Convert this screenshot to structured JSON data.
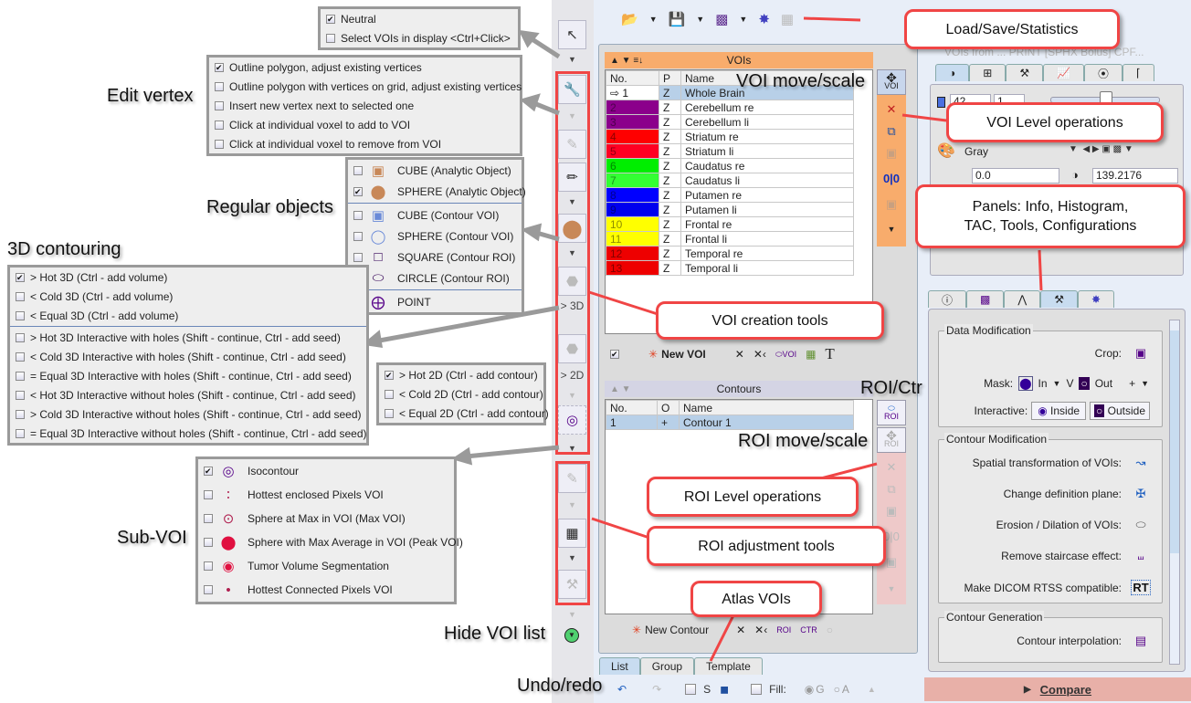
{
  "callouts": {
    "edit_vertex": "Edit vertex",
    "regular_objects": "Regular objects",
    "contouring_3d": "3D contouring",
    "sub_voi": "Sub-VOI",
    "hide_voi_list": "Hide VOI list",
    "undo_redo": "Undo/redo",
    "voi_move_scale": "VOI move/scale",
    "roi_ctr": "ROI/Ctr",
    "roi_move_scale": "ROI move/scale"
  },
  "bubbles": {
    "load_save": "Load/Save/Statistics",
    "voi_level": "VOI Level operations",
    "panels_line1": "Panels: Info, Histogram,",
    "panels_line2": "TAC, Tools, Configurations",
    "voi_creation": "VOI creation tools",
    "roi_level": "ROI Level operations",
    "roi_adjust": "ROI adjustment tools",
    "atlas": "Atlas VOIs"
  },
  "menus": {
    "select": [
      {
        "label": "Neutral",
        "checked": true
      },
      {
        "label": "Select VOIs in display <Ctrl+Click>",
        "checked": false
      }
    ],
    "edit_vertex": [
      {
        "label": "Outline polygon, adjust existing vertices",
        "checked": true
      },
      {
        "label": "Outline polygon with vertices on grid, adjust existing vertices",
        "checked": false
      },
      {
        "label": "Insert new vertex next to selected one",
        "checked": false
      },
      {
        "label": "Click at individual voxel to add to VOI",
        "checked": false
      },
      {
        "label": "Click at individual voxel to remove from VOI",
        "checked": false
      }
    ],
    "regular_objects": [
      {
        "label": "CUBE (Analytic Object)",
        "checked": false,
        "icon": "cube-analytic-icon"
      },
      {
        "label": "SPHERE (Analytic Object)",
        "checked": true,
        "icon": "sphere-analytic-icon"
      },
      {
        "label": "CUBE (Contour VOI)",
        "checked": false,
        "icon": "cube-contour-icon"
      },
      {
        "label": "SPHERE (Contour VOI)",
        "checked": false,
        "icon": "sphere-contour-icon"
      },
      {
        "label": "SQUARE (Contour ROI)",
        "checked": false,
        "icon": "square-icon"
      },
      {
        "label": "CIRCLE (Contour ROI)",
        "checked": false,
        "icon": "circle-icon"
      },
      {
        "label": "POINT",
        "checked": false,
        "icon": "point-icon"
      }
    ],
    "contouring_3d": [
      {
        "label": "> Hot 3D (Ctrl - add volume)",
        "checked": true
      },
      {
        "label": "< Cold 3D (Ctrl - add volume)",
        "checked": false
      },
      {
        "label": "< Equal 3D (Ctrl - add volume)",
        "checked": false
      },
      {
        "label": "> Hot 3D Interactive with holes (Shift - continue, Ctrl - add seed)",
        "checked": false
      },
      {
        "label": "< Cold 3D Interactive with holes (Shift - continue, Ctrl - add seed)",
        "checked": false
      },
      {
        "label": "= Equal 3D Interactive with holes (Shift - continue, Ctrl - add seed)",
        "checked": false
      },
      {
        "label": "< Hot 3D Interactive without holes (Shift - continue, Ctrl - add seed)",
        "checked": false
      },
      {
        "label": "> Cold 3D Interactive without holes (Shift - continue, Ctrl - add seed)",
        "checked": false
      },
      {
        "label": "= Equal 3D Interactive without holes (Shift - continue, Ctrl - add seed)",
        "checked": false
      }
    ],
    "contouring_2d": [
      {
        "label": "> Hot 2D (Ctrl - add contour)",
        "checked": true
      },
      {
        "label": "< Cold 2D (Ctrl - add contour)",
        "checked": false
      },
      {
        "label": "< Equal 2D (Ctrl - add contour)",
        "checked": false
      }
    ],
    "sub_voi": [
      {
        "label": "Isocontour",
        "checked": true,
        "icon": "isocontour-icon"
      },
      {
        "label": "Hottest enclosed Pixels VOI",
        "checked": false,
        "icon": "hottest-enclosed-icon"
      },
      {
        "label": "Sphere at Max in VOI (Max VOI)",
        "checked": false,
        "icon": "max-voi-icon"
      },
      {
        "label": "Sphere with Max Average in VOI (Peak VOI)",
        "checked": false,
        "icon": "peak-voi-icon"
      },
      {
        "label": "Tumor Volume Segmentation",
        "checked": false,
        "icon": "tumor-segmentation-icon"
      },
      {
        "label": "Hottest Connected Pixels VOI",
        "checked": false,
        "icon": "hottest-connected-icon"
      }
    ]
  },
  "toolstrip": {
    "label_3d": "> 3D",
    "label_2d": "> 2D"
  },
  "voi_panel": {
    "header": "VOIs",
    "columns": [
      "No.",
      "P",
      "Name"
    ],
    "rows": [
      {
        "no": "1",
        "p": "Z",
        "name": "Whole Brain",
        "color": "#ffffff",
        "selected": true
      },
      {
        "no": "2",
        "p": "Z",
        "name": "Cerebellum re",
        "color": "#8b008b"
      },
      {
        "no": "3",
        "p": "Z",
        "name": "Cerebellum li",
        "color": "#8b008b"
      },
      {
        "no": "4",
        "p": "Z",
        "name": "Striatum re",
        "color": "#ff0000"
      },
      {
        "no": "5",
        "p": "Z",
        "name": "Striatum li",
        "color": "#ff0022"
      },
      {
        "no": "6",
        "p": "Z",
        "name": "Caudatus re",
        "color": "#00ee00"
      },
      {
        "no": "7",
        "p": "Z",
        "name": "Caudatus li",
        "color": "#33ff33"
      },
      {
        "no": "8",
        "p": "Z",
        "name": "Putamen re",
        "color": "#0000ff"
      },
      {
        "no": "9",
        "p": "Z",
        "name": "Putamen li",
        "color": "#0000ee"
      },
      {
        "no": "10",
        "p": "Z",
        "name": "Frontal re",
        "color": "#ffff00"
      },
      {
        "no": "11",
        "p": "Z",
        "name": "Frontal li",
        "color": "#ffff00"
      },
      {
        "no": "12",
        "p": "Z",
        "name": "Temporal re",
        "color": "#ee0000"
      },
      {
        "no": "13",
        "p": "Z",
        "name": "Temporal li",
        "color": "#ee0000"
      }
    ],
    "new_voi": "New VOI",
    "voi_tag": "VOI"
  },
  "contour_panel": {
    "header": "Contours",
    "columns": [
      "No.",
      "O",
      "Name"
    ],
    "rows": [
      {
        "no": "1",
        "o": "+",
        "name": "Contour 1"
      }
    ],
    "new_contour": "New Contour",
    "roi_tag": "ROI",
    "ctr_tag": "CTR"
  },
  "bottom_tabs": [
    "List",
    "Group",
    "Template"
  ],
  "bottom_bar": {
    "s_label": "S",
    "fill_label": "Fill:",
    "g_label": "G",
    "a_label": "A"
  },
  "right_panel": {
    "top_tabs": [
      "contrast-icon",
      "layout-icon",
      "tools-icon",
      "chart-icon",
      "signal-icon",
      "probe-icon"
    ],
    "slice_value": "42",
    "slice_step": "1",
    "second_value": "1",
    "colormap": "Gray",
    "min_value": "0.0",
    "max_value": "139.2176",
    "panel_tabs": [
      "info-icon",
      "histogram-icon",
      "tac-icon",
      "tools-icon",
      "config-icon"
    ],
    "data_modification": {
      "title": "Data Modification",
      "crop": "Crop:",
      "mask": "Mask:",
      "in": "In",
      "v": "V",
      "out": "Out",
      "plus": "+",
      "interactive": "Interactive:",
      "inside": "Inside",
      "outside": "Outside"
    },
    "contour_modification": {
      "title": "Contour Modification",
      "items": [
        "Spatial transformation of VOIs:",
        "Change definition plane:",
        "Erosion / Dilation of VOIs:",
        "Remove staircase effect:",
        "Make DICOM RTSS compatible:"
      ],
      "rt_label": "RT"
    },
    "contour_generation": {
      "title": "Contour Generation",
      "items": [
        "Contour interpolation:"
      ]
    },
    "compare": "Compare",
    "header_text": "VOIs from ... PRINT [SPHX Bolus] CPF..."
  }
}
